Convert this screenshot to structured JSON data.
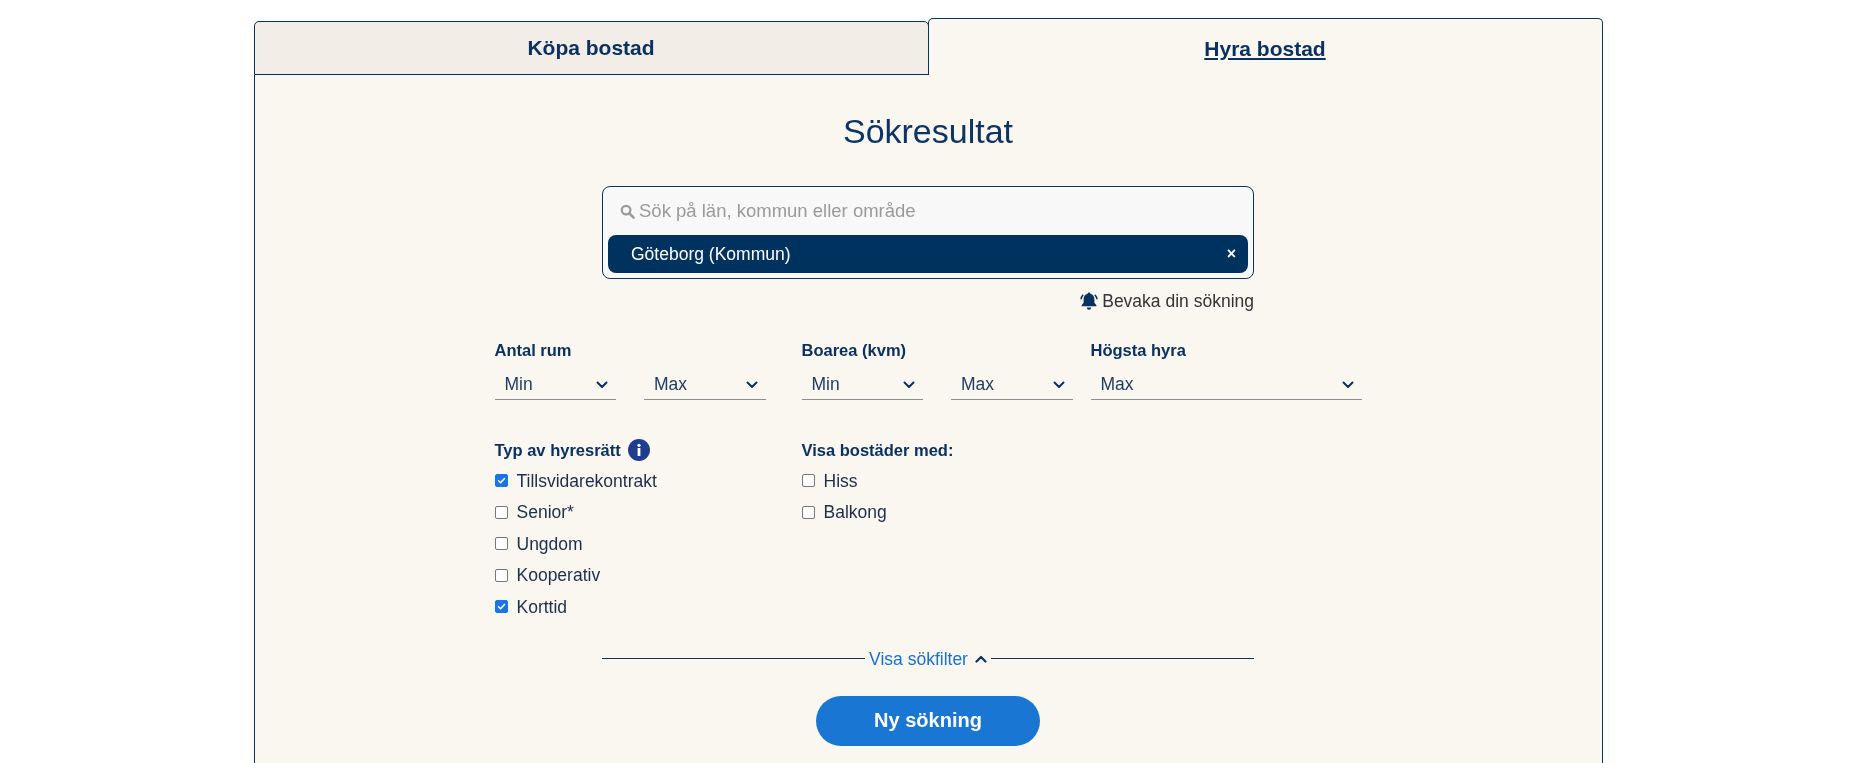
{
  "tabs": [
    {
      "label": "Köpa bostad",
      "selected": false
    },
    {
      "label": "Hyra bostad",
      "selected": true
    }
  ],
  "heading": "Sökresultat",
  "search": {
    "placeholder": "Sök på län, kommun eller område",
    "tags": [
      {
        "label": "Göteborg (Kommun)",
        "remove": "×"
      }
    ]
  },
  "watch_link": "Bevaka din sökning",
  "filters": [
    {
      "label": "Antal rum",
      "selects": [
        {
          "value": "Min"
        },
        {
          "value": "Max"
        }
      ]
    },
    {
      "label": "Boarea (kvm)",
      "selects": [
        {
          "value": "Min"
        },
        {
          "value": "Max"
        }
      ]
    },
    {
      "label": "Högsta hyra",
      "selects": [
        {
          "value": "Max"
        }
      ]
    }
  ],
  "checkbox_groups": [
    {
      "label": "Typ av hyresrätt",
      "info": true,
      "options": [
        {
          "label": "Tillsvidarekontrakt",
          "checked": true
        },
        {
          "label": "Senior*",
          "checked": false
        },
        {
          "label": "Ungdom",
          "checked": false
        },
        {
          "label": "Kooperativ",
          "checked": false
        },
        {
          "label": "Korttid",
          "checked": true
        }
      ]
    },
    {
      "label": "Visa bostäder med:",
      "info": false,
      "options": [
        {
          "label": "Hiss",
          "checked": false
        },
        {
          "label": "Balkong",
          "checked": false
        }
      ]
    }
  ],
  "filter_toggle": {
    "label": "Visa sökfilter",
    "expanded": true
  },
  "primary_button": "Ny sökning"
}
